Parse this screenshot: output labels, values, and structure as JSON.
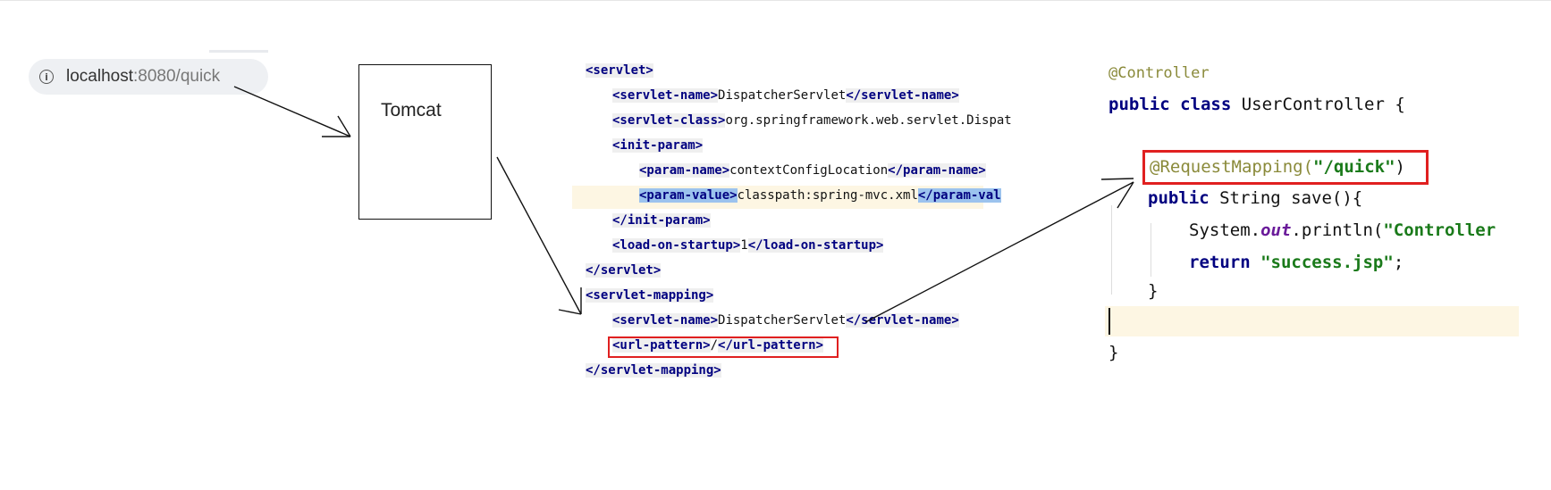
{
  "address_bar": {
    "info_icon": "info-icon",
    "host": "localhost",
    "port_path": ":8080/quick"
  },
  "server_box": {
    "label": "Tomcat"
  },
  "web_xml": {
    "lines": [
      {
        "indent": 0,
        "open": "<servlet>",
        "text": "",
        "close": ""
      },
      {
        "indent": 1,
        "open": "<servlet-name>",
        "text": "DispatcherServlet",
        "close": "</servlet-name>"
      },
      {
        "indent": 1,
        "open": "<servlet-class>",
        "text": "org.springframework.web.servlet.Dispat",
        "close": ""
      },
      {
        "indent": 1,
        "open": "<init-param>",
        "text": "",
        "close": ""
      },
      {
        "indent": 2,
        "open": "<param-name>",
        "text": "contextConfigLocation",
        "close": "</param-name>"
      },
      {
        "indent": 2,
        "open": "<param-value>",
        "text": "classpath:spring-mvc.xml",
        "close": "</param-val"
      },
      {
        "indent": 1,
        "open": "</init-param>",
        "text": "",
        "close": ""
      },
      {
        "indent": 1,
        "open": "<load-on-startup>",
        "text": "1",
        "close": "</load-on-startup>"
      },
      {
        "indent": 0,
        "open": "</servlet>",
        "text": "",
        "close": ""
      },
      {
        "indent": 0,
        "open": "<servlet-mapping>",
        "text": "",
        "close": ""
      },
      {
        "indent": 1,
        "open": "<servlet-name>",
        "text": "DispatcherServlet",
        "close": "</servlet-name>"
      },
      {
        "indent": 1,
        "open": "<url-pattern>",
        "text": "/",
        "close": "</url-pattern>"
      },
      {
        "indent": 0,
        "open": "</servlet-mapping>",
        "text": "",
        "close": ""
      }
    ]
  },
  "controller_code": {
    "annotation": "@Controller",
    "class_kw": "public class",
    "class_name": "UserController {",
    "mapping_annotation": "@RequestMapping(",
    "mapping_value": "\"/quick\"",
    "mapping_close": ")",
    "method_kw": "public",
    "method_sig": "String save(){",
    "print_prefix": "System.",
    "print_field": "out",
    "print_call": ".println(",
    "print_arg": "\"Controller",
    "return_kw": "return",
    "return_value": "\"success.jsp\"",
    "return_end": ";",
    "method_close": "}",
    "class_close": "}"
  },
  "colors": {
    "highlight_box": "#e02020",
    "xml_tag": "#000080",
    "selection": "#9cc3ee",
    "current_line": "#fdf6e3"
  }
}
